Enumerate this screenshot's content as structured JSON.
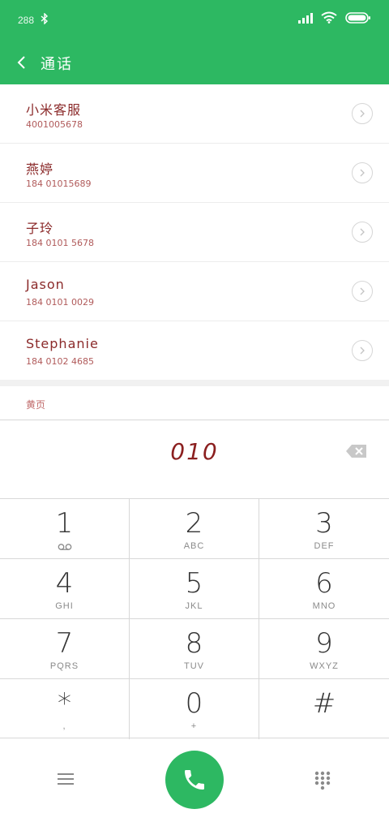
{
  "status_bar": {
    "speed": "288",
    "icons": [
      "bluetooth-icon",
      "signal-icon",
      "wifi-icon",
      "battery-icon"
    ]
  },
  "nav": {
    "title": "通话"
  },
  "contacts": [
    {
      "name": "小米客服",
      "number": "4001005678"
    },
    {
      "name": "燕婷",
      "number": "184 01015689"
    },
    {
      "name": "子玲",
      "number": "184 0101 5678"
    },
    {
      "name": "Jason",
      "number": "184 0101 0029"
    },
    {
      "name": "Stephanie",
      "number": "184 0102 4685"
    }
  ],
  "section_label": "黄页",
  "dial": {
    "number": "010"
  },
  "keys": [
    {
      "digit": "1",
      "letters": ""
    },
    {
      "digit": "2",
      "letters": "ABC"
    },
    {
      "digit": "3",
      "letters": "DEF"
    },
    {
      "digit": "4",
      "letters": "GHI"
    },
    {
      "digit": "5",
      "letters": "JKL"
    },
    {
      "digit": "6",
      "letters": "MNO"
    },
    {
      "digit": "7",
      "letters": "PQRS"
    },
    {
      "digit": "8",
      "letters": "TUV"
    },
    {
      "digit": "9",
      "letters": "WXYZ"
    },
    {
      "digit": "*",
      "letters": ","
    },
    {
      "digit": "0",
      "letters": "+"
    },
    {
      "digit": "#",
      "letters": ""
    }
  ],
  "colors": {
    "accent": "#2db862",
    "name_text": "#8b2a2a",
    "dialed_text": "#8b1f1f"
  }
}
